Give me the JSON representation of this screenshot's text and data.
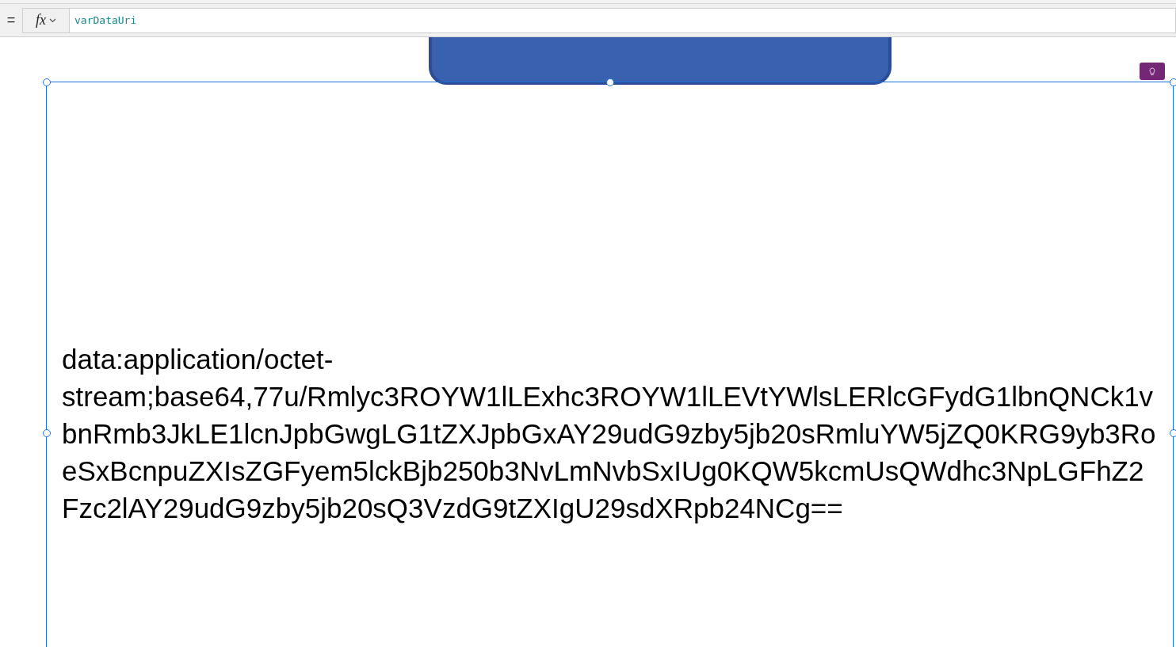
{
  "formula_bar": {
    "operator": "=",
    "function_button": "fx",
    "formula": "varDataUri"
  },
  "canvas": {
    "label": {
      "text": "data:application/octet-stream;base64,77u/Rmlyc3ROYW1lLExhc3ROYW1lLEVtYWlsLERlcGFydG1lbnQNCk1vbnRmb3JkLE1lcnJpbGwgLG1tZXJpbGxAY29udG9zby5jb20sRmluYW5jZQ0KRG9yb3RoeSxBcnpuZXIsZGFyem5lckBjb250b3NvLmNvbSxIUg0KQW5kcmUsQWdhc3NpLGFhZ2Fzc2lAY29udG9zby5jb20sQ3VzdG9tZXIgU29sdXRpb24NCg==",
      "selected": true
    }
  }
}
